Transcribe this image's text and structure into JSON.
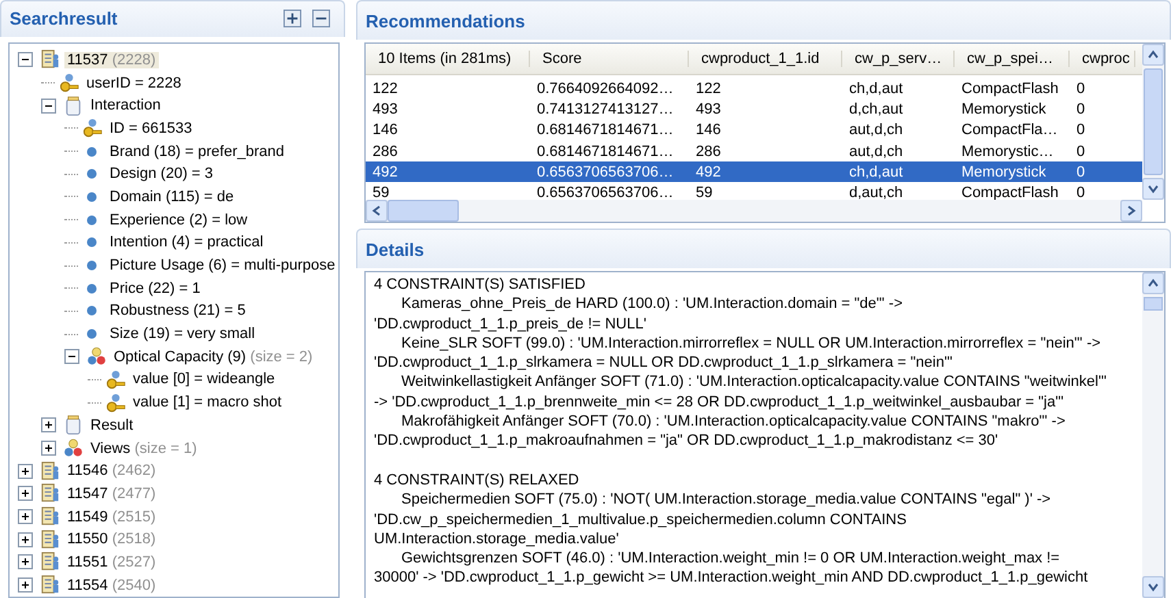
{
  "searchresult": {
    "title": "Searchresult",
    "tree": [
      {
        "label": "11537",
        "suffix": "(2228)",
        "kind": "record",
        "expanded": true,
        "selected": true,
        "children": [
          {
            "label": "userID = 2228",
            "kind": "key"
          },
          {
            "label": "Interaction",
            "kind": "table",
            "expanded": true,
            "children": [
              {
                "label": "ID = 661533",
                "kind": "key"
              },
              {
                "label": "Brand (18) = prefer_brand",
                "kind": "attribute"
              },
              {
                "label": "Design (20) = 3",
                "kind": "attribute"
              },
              {
                "label": "Domain (115) = de",
                "kind": "attribute"
              },
              {
                "label": "Experience (2) = low",
                "kind": "attribute"
              },
              {
                "label": "Intention (4) = practical",
                "kind": "attribute"
              },
              {
                "label": "Picture Usage (6) = multi-purpose",
                "kind": "attribute"
              },
              {
                "label": "Price (22) = 1",
                "kind": "attribute"
              },
              {
                "label": "Robustness (21) = 5",
                "kind": "attribute"
              },
              {
                "label": "Size (19) = very small",
                "kind": "attribute"
              },
              {
                "label": "Optical Capacity (9)",
                "suffix": "(size = 2)",
                "kind": "set",
                "expanded": true,
                "children": [
                  {
                    "label": "value [0] = wideangle",
                    "kind": "key"
                  },
                  {
                    "label": "value [1] = macro shot",
                    "kind": "key"
                  }
                ]
              }
            ]
          },
          {
            "label": "Result",
            "kind": "table",
            "expanded": false
          },
          {
            "label": "Views",
            "suffix": "(size = 1)",
            "kind": "set",
            "expanded": false
          }
        ]
      },
      {
        "label": "11546",
        "suffix": "(2462)",
        "kind": "record",
        "expanded": false,
        "selected": false
      },
      {
        "label": "11547",
        "suffix": "(2477)",
        "kind": "record",
        "expanded": false,
        "selected": false
      },
      {
        "label": "11549",
        "suffix": "(2515)",
        "kind": "record",
        "expanded": false,
        "selected": false
      },
      {
        "label": "11550",
        "suffix": "(2518)",
        "kind": "record",
        "expanded": false,
        "selected": false
      },
      {
        "label": "11551",
        "suffix": "(2527)",
        "kind": "record",
        "expanded": false,
        "selected": false
      },
      {
        "label": "11554",
        "suffix": "(2540)",
        "kind": "record",
        "expanded": false,
        "selected": false
      }
    ]
  },
  "recommendations": {
    "title": "Recommendations",
    "columns": [
      "10 Items (in 281ms)",
      "Score",
      "cwproduct_1_1.id",
      "cw_p_serv…",
      "cw_p_spei…",
      "cwproc"
    ],
    "rows": [
      {
        "cells": [
          "122",
          "0.7664092664092…",
          "122",
          "ch,d,aut",
          "CompactFlash",
          "0"
        ],
        "selected": false
      },
      {
        "cells": [
          "493",
          "0.7413127413127…",
          "493",
          "d,ch,aut",
          "Memorystick",
          "0"
        ],
        "selected": false
      },
      {
        "cells": [
          "146",
          "0.6814671814671…",
          "146",
          "aut,d,ch",
          "CompactFla…",
          "0"
        ],
        "selected": false
      },
      {
        "cells": [
          "286",
          "0.6814671814671…",
          "286",
          "aut,d,ch",
          "Memorystic…",
          "0"
        ],
        "selected": false
      },
      {
        "cells": [
          "492",
          "0.6563706563706…",
          "492",
          "ch,d,aut",
          "Memorystick",
          "0"
        ],
        "selected": true
      },
      {
        "cells": [
          "59",
          "0.6563706563706…",
          "59",
          "d,aut,ch",
          "CompactFlash",
          "0"
        ],
        "selected": false
      }
    ]
  },
  "details": {
    "title": "Details",
    "blocks": [
      {
        "kind": "heading",
        "text": "4 CONSTRAINT(S) SATISFIED"
      },
      {
        "kind": "constraint",
        "lines": [
          "Kameras_ohne_Preis_de HARD (100.0) : 'UM.Interaction.domain = \"de\"' ->",
          "'DD.cwproduct_1_1.p_preis_de  != NULL'"
        ]
      },
      {
        "kind": "constraint",
        "lines": [
          "Keine_SLR SOFT (99.0) : 'UM.Interaction.mirrorreflex = NULL OR UM.Interaction.mirrorreflex = \"nein\"' ->",
          "'DD.cwproduct_1_1.p_slrkamera = NULL OR DD.cwproduct_1_1.p_slrkamera = \"nein\"'"
        ]
      },
      {
        "kind": "constraint",
        "lines": [
          "Weitwinkellastigkeit Anfänger SOFT (71.0) : 'UM.Interaction.opticalcapacity.value CONTAINS \"weitwinkel\"'",
          "-> 'DD.cwproduct_1_1.p_brennweite_min <= 28 OR DD.cwproduct_1_1.p_weitwinkel_ausbaubar = \"ja\"'"
        ]
      },
      {
        "kind": "constraint",
        "lines": [
          "Makrofähigkeit Anfänger SOFT (70.0) : 'UM.Interaction.opticalcapacity.value CONTAINS \"makro\"' ->",
          "'DD.cwproduct_1_1.p_makroaufnahmen = \"ja\" OR DD.cwproduct_1_1.p_makrodistanz <= 30'"
        ]
      },
      {
        "kind": "heading",
        "text": "4 CONSTRAINT(S) RELAXED"
      },
      {
        "kind": "constraint",
        "lines": [
          "Speichermedien SOFT (75.0) : 'NOT( UM.Interaction.storage_media.value CONTAINS \"egal\" )' ->",
          "'DD.cw_p_speichermedien_1_multivalue.p_speichermedien.column CONTAINS",
          "UM.Interaction.storage_media.value'"
        ]
      },
      {
        "kind": "constraint",
        "lines": [
          "Gewichtsgrenzen SOFT (46.0) : 'UM.Interaction.weight_min != 0 OR UM.Interaction.weight_max !=",
          "30000' -> 'DD.cwproduct_1_1.p_gewicht >=  UM.Interaction.weight_min AND DD.cwproduct_1_1.p_gewicht"
        ]
      }
    ]
  }
}
